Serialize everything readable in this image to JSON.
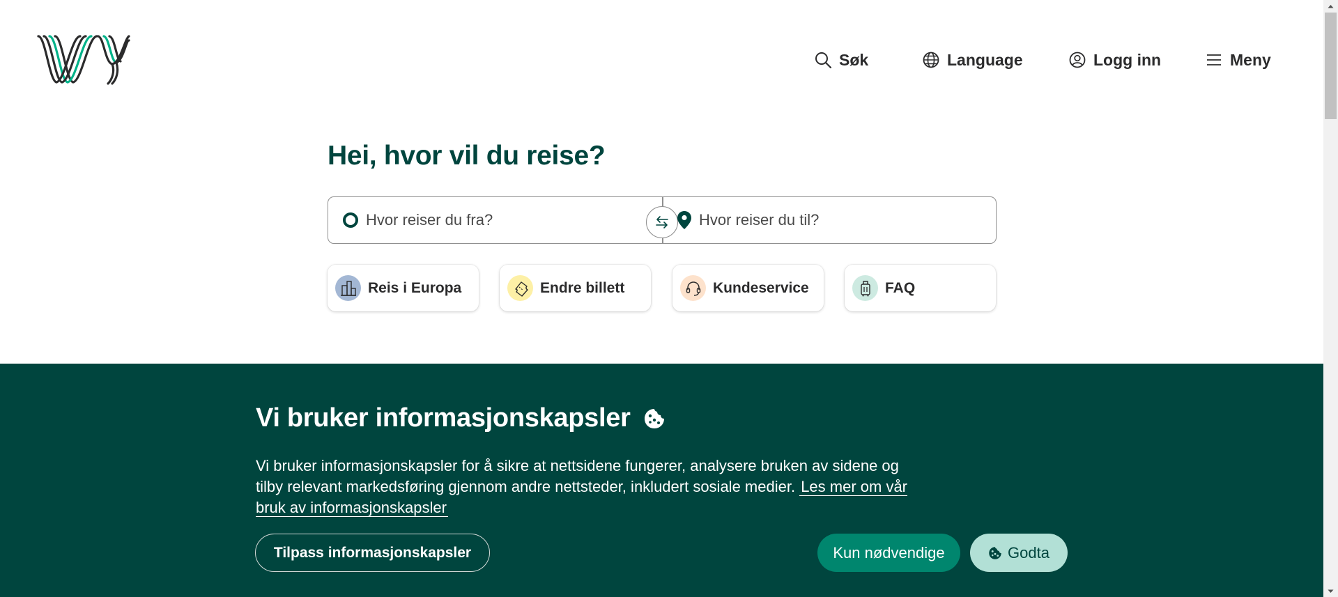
{
  "header": {
    "logo_alt": "Vy",
    "nav": {
      "search": "Søk",
      "language": "Language",
      "login": "Logg inn",
      "menu": "Meny"
    }
  },
  "hero": {
    "title": "Hei, hvor vil du reise?",
    "from_placeholder": "Hvor reiser du fra?",
    "to_placeholder": "Hvor reiser du til?",
    "swap_label": "Bytt fra og til"
  },
  "quick_links": [
    {
      "label": "Reis i Europa",
      "icon": "buildings-icon",
      "color": "#a3b7d4"
    },
    {
      "label": "Endre billett",
      "icon": "ticket-icon",
      "color": "#fdf0a6"
    },
    {
      "label": "Kundeservice",
      "icon": "headset-icon",
      "color": "#fde2cc"
    },
    {
      "label": "FAQ",
      "icon": "luggage-icon",
      "color": "#cdeae1"
    }
  ],
  "cookie_banner": {
    "title": "Vi bruker informasjonskapsler",
    "text": "Vi bruker informasjonskapsler for å sikre at nettsidene fungerer, analysere bruken av sidene og tilby relevant markedsføring gjennom andre nettsteder, inkludert sosiale medier.",
    "link": "Les mer om vår bruk av informasjonskapsler",
    "customize_button": "Tilpass informasjonskapsler",
    "necessary_button": "Kun nødvendige",
    "accept_button": "Godta"
  },
  "colors": {
    "brand_dark": "#00453e",
    "brand_green": "#00866e",
    "brand_mint": "#b2e0d6",
    "logo_accent": "#00b289"
  }
}
